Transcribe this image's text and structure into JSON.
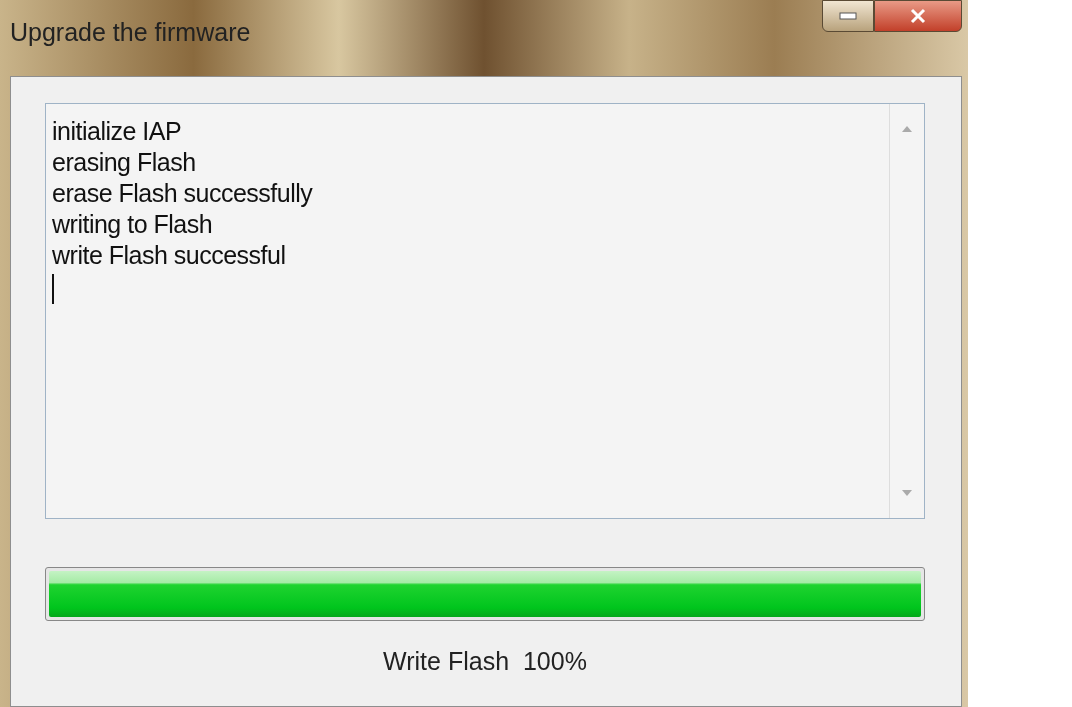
{
  "window": {
    "title": "Upgrade the firmware"
  },
  "log": {
    "lines": [
      "initialize IAP",
      "erasing Flash",
      "erase Flash successfully",
      "writing to Flash",
      "write Flash successful"
    ]
  },
  "progress": {
    "level": 1.0
  },
  "status": "Write Flash  100%"
}
